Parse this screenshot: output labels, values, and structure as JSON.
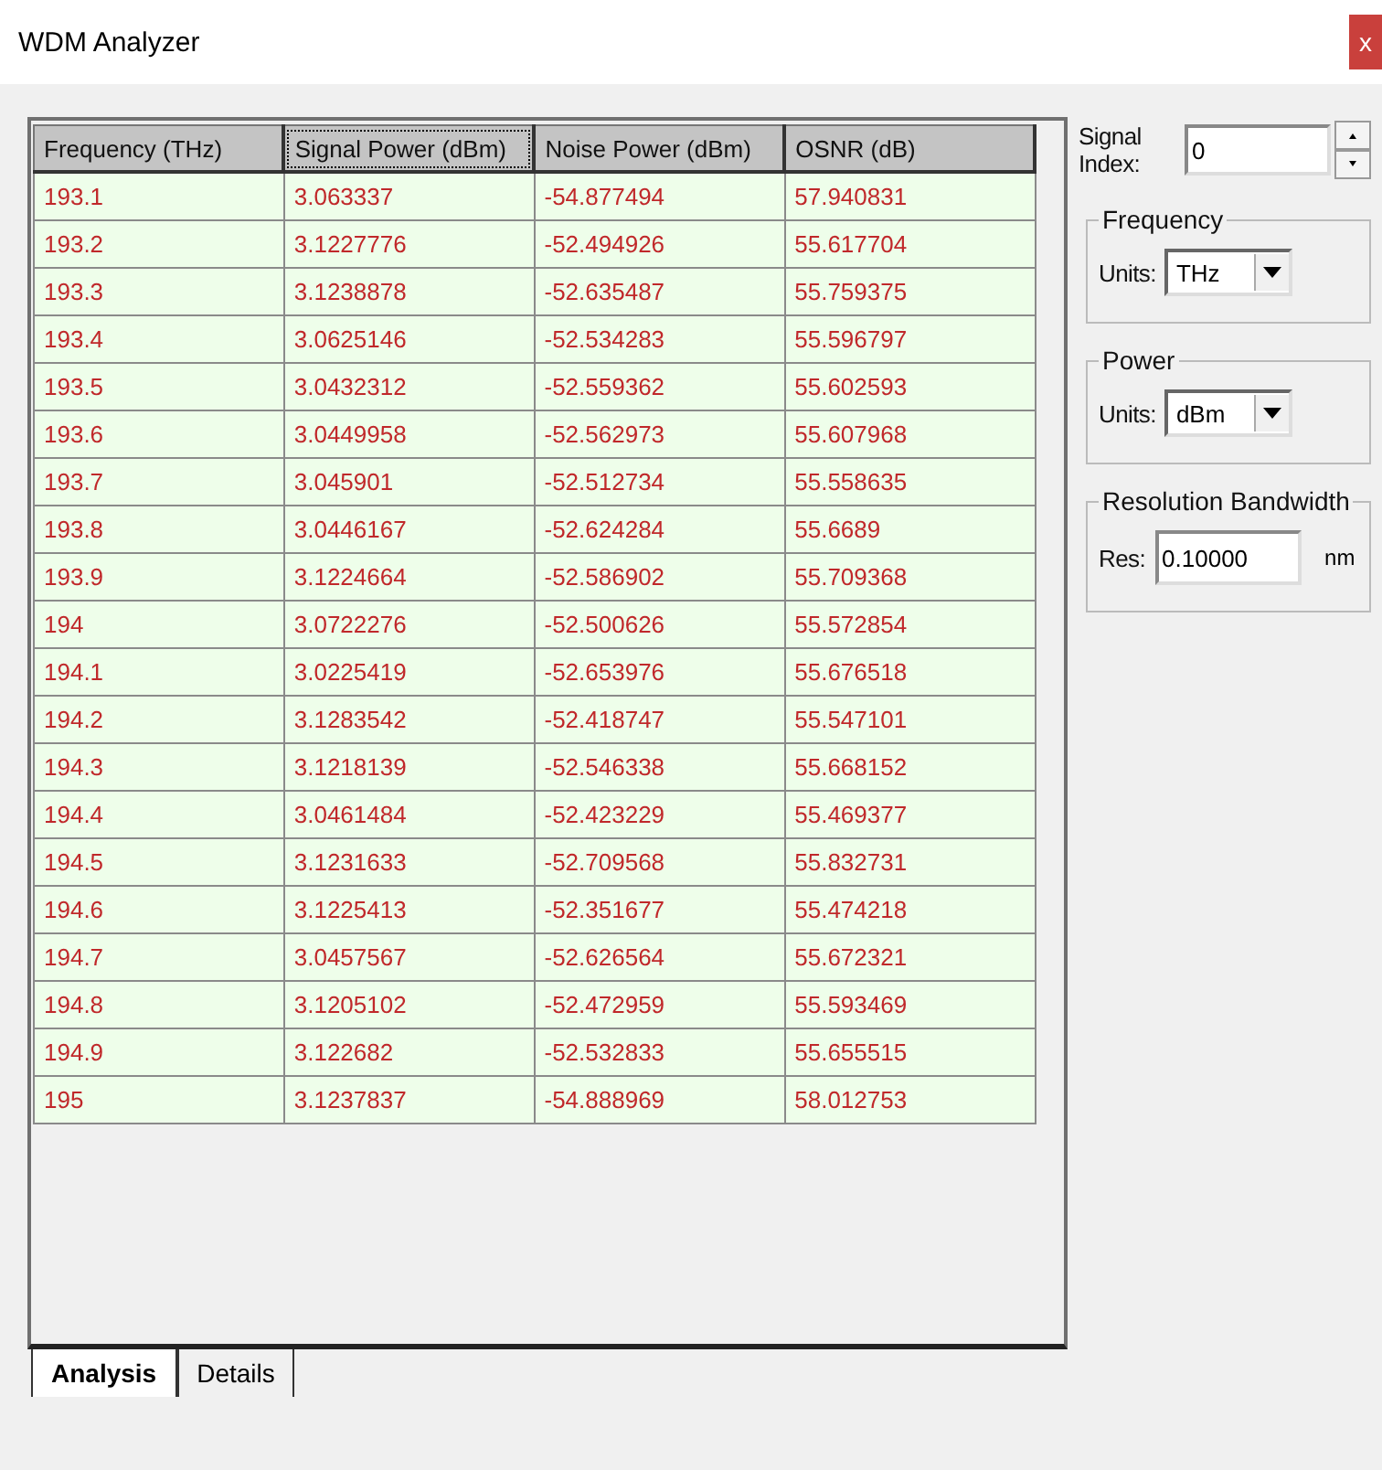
{
  "window": {
    "title": "WDM Analyzer",
    "close": "x"
  },
  "table": {
    "columns": [
      {
        "label": "Frequency (THz)",
        "focused": false
      },
      {
        "label": "Signal Power (dBm)",
        "focused": true
      },
      {
        "label": "Noise Power (dBm)",
        "focused": false
      },
      {
        "label": "OSNR (dB)",
        "focused": false
      }
    ],
    "rows": [
      [
        "193.1",
        "3.063337",
        "-54.877494",
        "57.940831"
      ],
      [
        "193.2",
        "3.1227776",
        "-52.494926",
        "55.617704"
      ],
      [
        "193.3",
        "3.1238878",
        "-52.635487",
        "55.759375"
      ],
      [
        "193.4",
        "3.0625146",
        "-52.534283",
        "55.596797"
      ],
      [
        "193.5",
        "3.0432312",
        "-52.559362",
        "55.602593"
      ],
      [
        "193.6",
        "3.0449958",
        "-52.562973",
        "55.607968"
      ],
      [
        "193.7",
        "3.045901",
        "-52.512734",
        "55.558635"
      ],
      [
        "193.8",
        "3.0446167",
        "-52.624284",
        "55.6689"
      ],
      [
        "193.9",
        "3.1224664",
        "-52.586902",
        "55.709368"
      ],
      [
        "194",
        "3.0722276",
        "-52.500626",
        "55.572854"
      ],
      [
        "194.1",
        "3.0225419",
        "-52.653976",
        "55.676518"
      ],
      [
        "194.2",
        "3.1283542",
        "-52.418747",
        "55.547101"
      ],
      [
        "194.3",
        "3.1218139",
        "-52.546338",
        "55.668152"
      ],
      [
        "194.4",
        "3.0461484",
        "-52.423229",
        "55.469377"
      ],
      [
        "194.5",
        "3.1231633",
        "-52.709568",
        "55.832731"
      ],
      [
        "194.6",
        "3.1225413",
        "-52.351677",
        "55.474218"
      ],
      [
        "194.7",
        "3.0457567",
        "-52.626564",
        "55.672321"
      ],
      [
        "194.8",
        "3.1205102",
        "-52.472959",
        "55.593469"
      ],
      [
        "194.9",
        "3.122682",
        "-52.532833",
        "55.655515"
      ],
      [
        "195",
        "3.1237837",
        "-54.888969",
        "58.012753"
      ]
    ]
  },
  "tabs": [
    {
      "label": "Analysis",
      "selected": true
    },
    {
      "label": "Details",
      "selected": false
    }
  ],
  "signal_index": {
    "label": "Signal Index:",
    "value": "0"
  },
  "groups": [
    {
      "title": "Frequency",
      "kind": "select",
      "label": "Units:",
      "value": "THz"
    },
    {
      "title": "Power",
      "kind": "select",
      "label": "Units:",
      "value": "dBm"
    },
    {
      "title": "Resolution Bandwidth",
      "kind": "input",
      "label": "Res:",
      "value": "0.10000",
      "unit": "nm"
    }
  ]
}
